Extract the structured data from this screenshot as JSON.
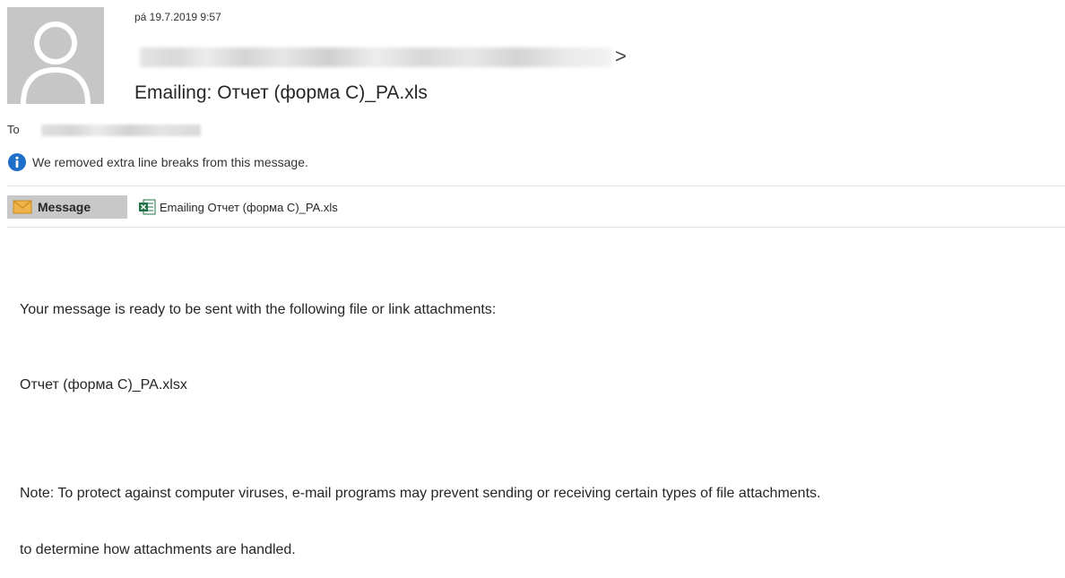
{
  "header": {
    "date": "pá 19.7.2019 9:57",
    "sender_suffix": ">",
    "subject": "Emailing: Отчет (форма С)_PA.xls",
    "to_label": "To"
  },
  "infobar": {
    "text": "We removed extra line breaks from this message."
  },
  "tabs": {
    "message_label": "Message",
    "attachment_label": "Emailing Отчет (форма С)_PA.xls"
  },
  "body": {
    "paragraph1": "Your message is ready to be sent with the following file or link attachments:",
    "attachment_name": "Отчет (форма С)_PA.xlsx",
    "note_line1": "Note: To protect against computer viruses, e-mail programs may prevent sending or receiving certain types of file attachments.",
    "note_line2": "to determine how attachments are handled."
  },
  "colors": {
    "avatar_bg": "#c6c6c6",
    "info_blue": "#1e6fc9",
    "tab_active_bg": "#c8c8c8",
    "excel_green": "#217346",
    "envelope_orange": "#f0b34a"
  },
  "icons": {
    "avatar": "person-silhouette-icon",
    "info": "info-circle-icon",
    "message": "envelope-icon",
    "attachment": "excel-file-icon"
  }
}
